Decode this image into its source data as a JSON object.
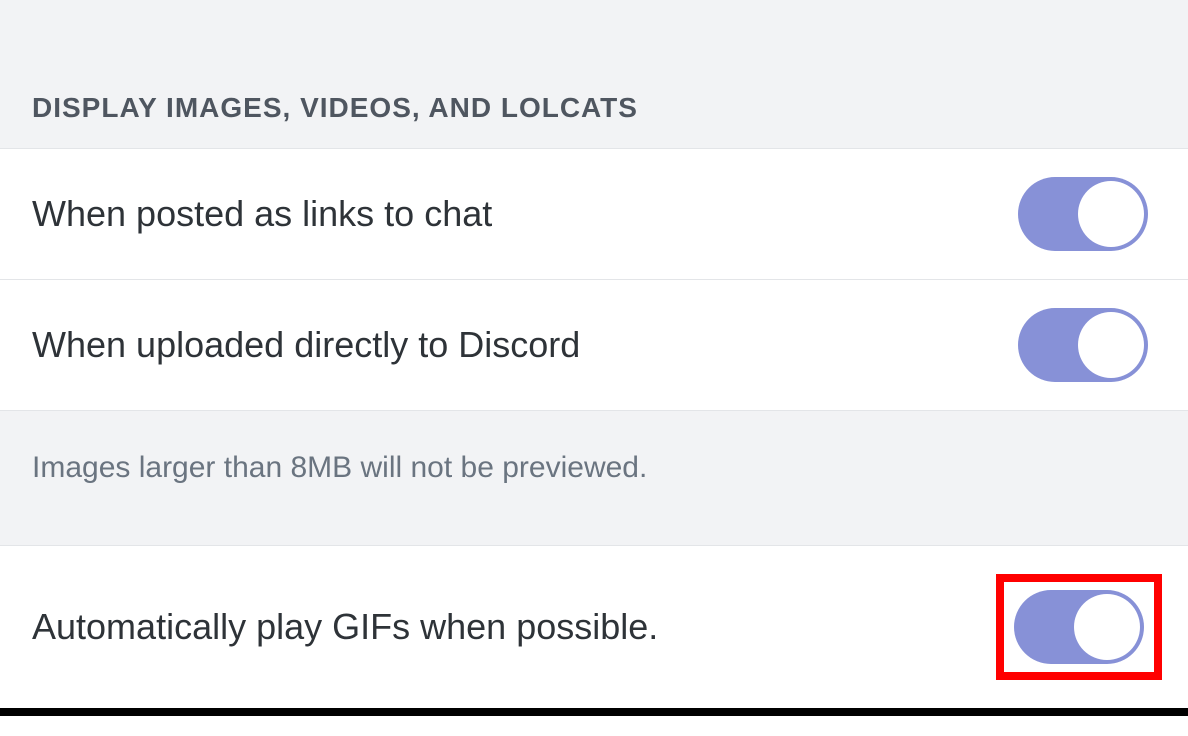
{
  "section": {
    "title": "DISPLAY IMAGES, VIDEOS, AND LOLCATS",
    "items": [
      {
        "label": "When posted as links to chat",
        "enabled": true
      },
      {
        "label": "When uploaded directly to Discord",
        "enabled": true
      }
    ],
    "help_text": "Images larger than 8MB will not be previewed."
  },
  "gif_setting": {
    "label": "Automatically play GIFs when possible.",
    "enabled": true,
    "highlighted": true
  },
  "colors": {
    "toggle_on": "#8791d7",
    "header_bg": "#f2f3f5",
    "text_primary": "#2e3338",
    "text_secondary": "#4f5660",
    "text_muted": "#6a7480",
    "highlight": "#ff0000"
  }
}
